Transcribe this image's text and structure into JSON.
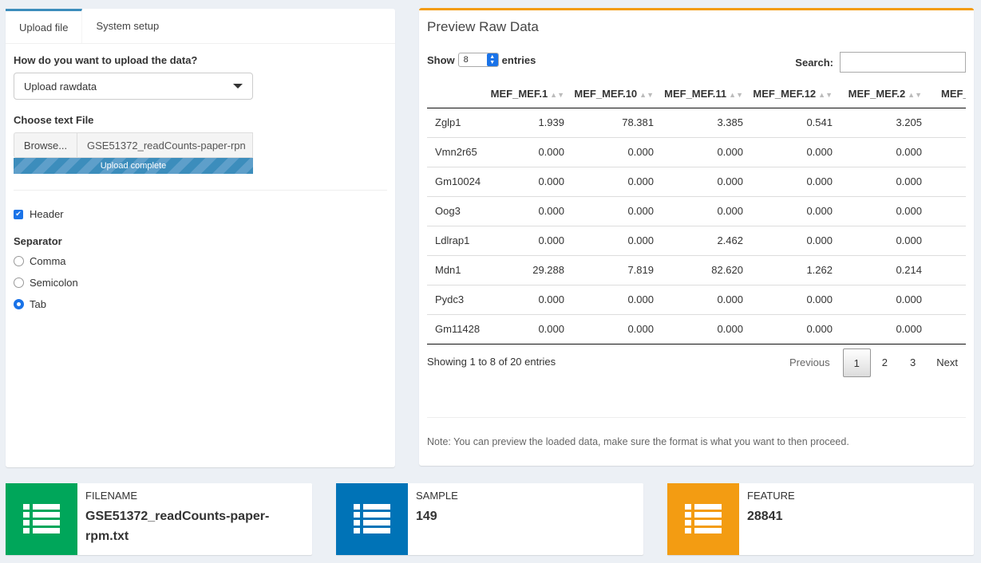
{
  "tabs": [
    {
      "label": "Upload file",
      "active": true
    },
    {
      "label": "System setup",
      "active": false
    }
  ],
  "upload": {
    "question": "How do you want to upload the data?",
    "method": "Upload rawdata",
    "file_label": "Choose text File",
    "browse_label": "Browse...",
    "file_name": "GSE51372_readCounts-paper-rpn",
    "progress_text": "Upload complete",
    "header_label": "Header",
    "header_checked": true,
    "separator_label": "Separator",
    "separators": [
      {
        "label": "Comma",
        "selected": false
      },
      {
        "label": "Semicolon",
        "selected": false
      },
      {
        "label": "Tab",
        "selected": true
      }
    ]
  },
  "preview": {
    "title": "Preview Raw Data",
    "show_label": "Show",
    "show_value": "8",
    "entries_label": "entries",
    "search_label": "Search:",
    "columns": [
      "MEF_MEF.1",
      "MEF_MEF.10",
      "MEF_MEF.11",
      "MEF_MEF.12",
      "MEF_MEF.2",
      "MEF_ME"
    ],
    "rows": [
      [
        "Zglp1",
        "1.939",
        "78.381",
        "3.385",
        "0.541",
        "3.205"
      ],
      [
        "Vmn2r65",
        "0.000",
        "0.000",
        "0.000",
        "0.000",
        "0.000"
      ],
      [
        "Gm10024",
        "0.000",
        "0.000",
        "0.000",
        "0.000",
        "0.000"
      ],
      [
        "Oog3",
        "0.000",
        "0.000",
        "0.000",
        "0.000",
        "0.000"
      ],
      [
        "Ldlrap1",
        "0.000",
        "0.000",
        "2.462",
        "0.000",
        "0.000"
      ],
      [
        "Mdn1",
        "29.288",
        "7.819",
        "82.620",
        "1.262",
        "0.214"
      ],
      [
        "Pydc3",
        "0.000",
        "0.000",
        "0.000",
        "0.000",
        "0.000"
      ],
      [
        "Gm11428",
        "0.000",
        "0.000",
        "0.000",
        "0.000",
        "0.000"
      ]
    ],
    "info": "Showing 1 to 8 of 20 entries",
    "prev_label": "Previous",
    "pages": [
      "1",
      "2",
      "3"
    ],
    "current_page": "1",
    "next_label": "Next",
    "note": "Note: You can preview the loaded data, make sure the format is what you want to then proceed."
  },
  "info_boxes": [
    {
      "title": "FILENAME",
      "value": "GSE51372_readCounts-paper-rpm.txt",
      "color": "#00a65a",
      "icon": "list-icon"
    },
    {
      "title": "SAMPLE",
      "value": "149",
      "color": "#0073b7",
      "icon": "list-icon"
    },
    {
      "title": "FEATURE",
      "value": "28841",
      "color": "#f39c12",
      "icon": "list-icon"
    }
  ]
}
